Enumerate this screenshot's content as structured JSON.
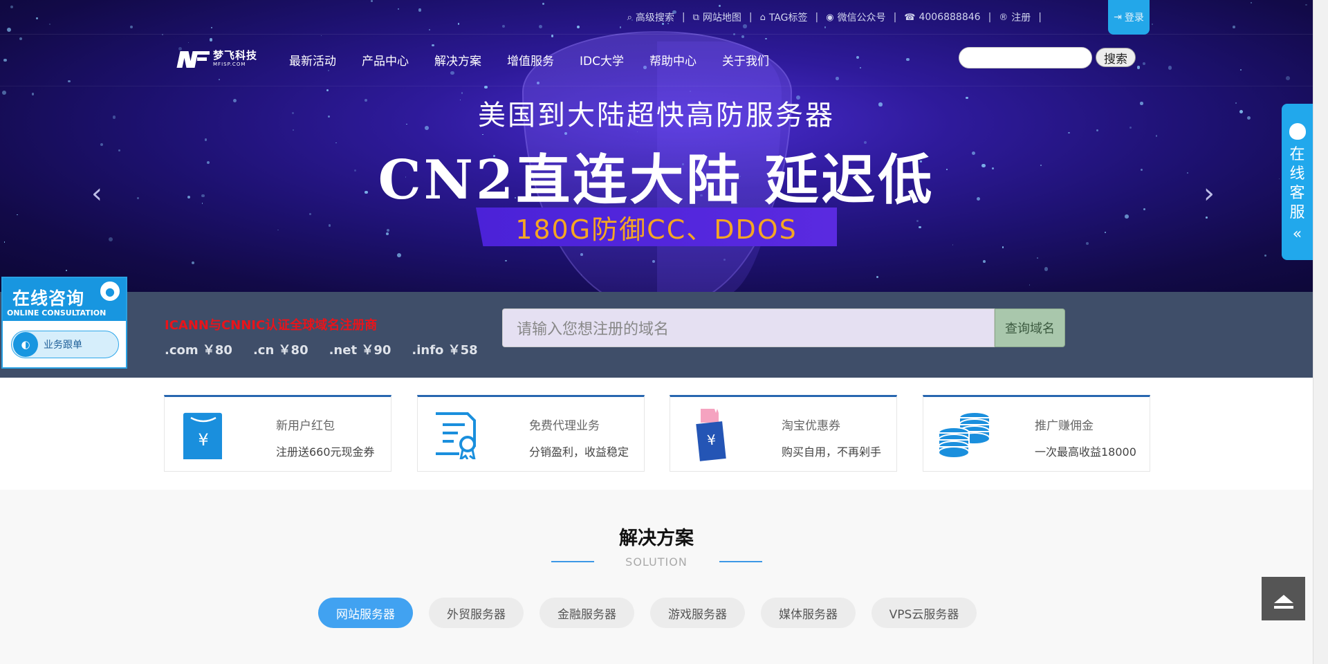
{
  "topbar": {
    "advanced_search": "高级搜索",
    "sitemap": "网站地图",
    "tag": "TAG标签",
    "wechat": "微信公众号",
    "phone": "4006888846",
    "register": "注册",
    "login": "登录",
    "separator": "|"
  },
  "logo": {
    "cn": "梦飞科技",
    "en": "MFISP.COM"
  },
  "nav": {
    "items": [
      "最新活动",
      "产品中心",
      "解决方案",
      "增值服务",
      "IDC大学",
      "帮助中心",
      "关于我们"
    ],
    "search_button": "搜索"
  },
  "hero": {
    "subtitle": "美国到大陆超快高防服务器",
    "title": "CN2直连大陆 延迟低",
    "band": "180G防御CC、DDOS"
  },
  "domain": {
    "title": "ICANN与CNNIC认证全球域名注册商",
    "prices": [
      ".com ￥80",
      ".cn ￥80",
      ".net ￥90",
      ".info ￥58"
    ],
    "placeholder": "请输入您想注册的域名",
    "button": "查询域名"
  },
  "features": [
    {
      "title": "新用户红包",
      "desc": "注册送660元现金券",
      "icon": "red-envelope-icon"
    },
    {
      "title": "免费代理业务",
      "desc": "分销盈利，收益稳定",
      "icon": "certificate-icon"
    },
    {
      "title": "淘宝优惠券",
      "desc": "购买自用，不再剁手",
      "icon": "coupon-icon"
    },
    {
      "title": "推广赚佣金",
      "desc": "一次最高收益18000",
      "icon": "coins-icon"
    }
  ],
  "solutions": {
    "title": "解决方案",
    "subtitle": "SOLUTION",
    "tabs": [
      "网站服务器",
      "外贸服务器",
      "金融服务器",
      "游戏服务器",
      "媒体服务器",
      "VPS云服务器"
    ],
    "active_tab": 0
  },
  "widgets": {
    "consult_cn": "在线咨询",
    "consult_en": "ONLINE CONSULTATION",
    "consult_button": "业务跟单",
    "side_service": "在线客服",
    "back_to_top": "back-to-top-icon"
  },
  "colors": {
    "accent": "#23a7e9",
    "nav_text": "#ffffff",
    "domain_title": "#e8141b",
    "band_text": "#f5a623",
    "card_border": "#2866b0",
    "tab_active": "#41a2f1"
  }
}
